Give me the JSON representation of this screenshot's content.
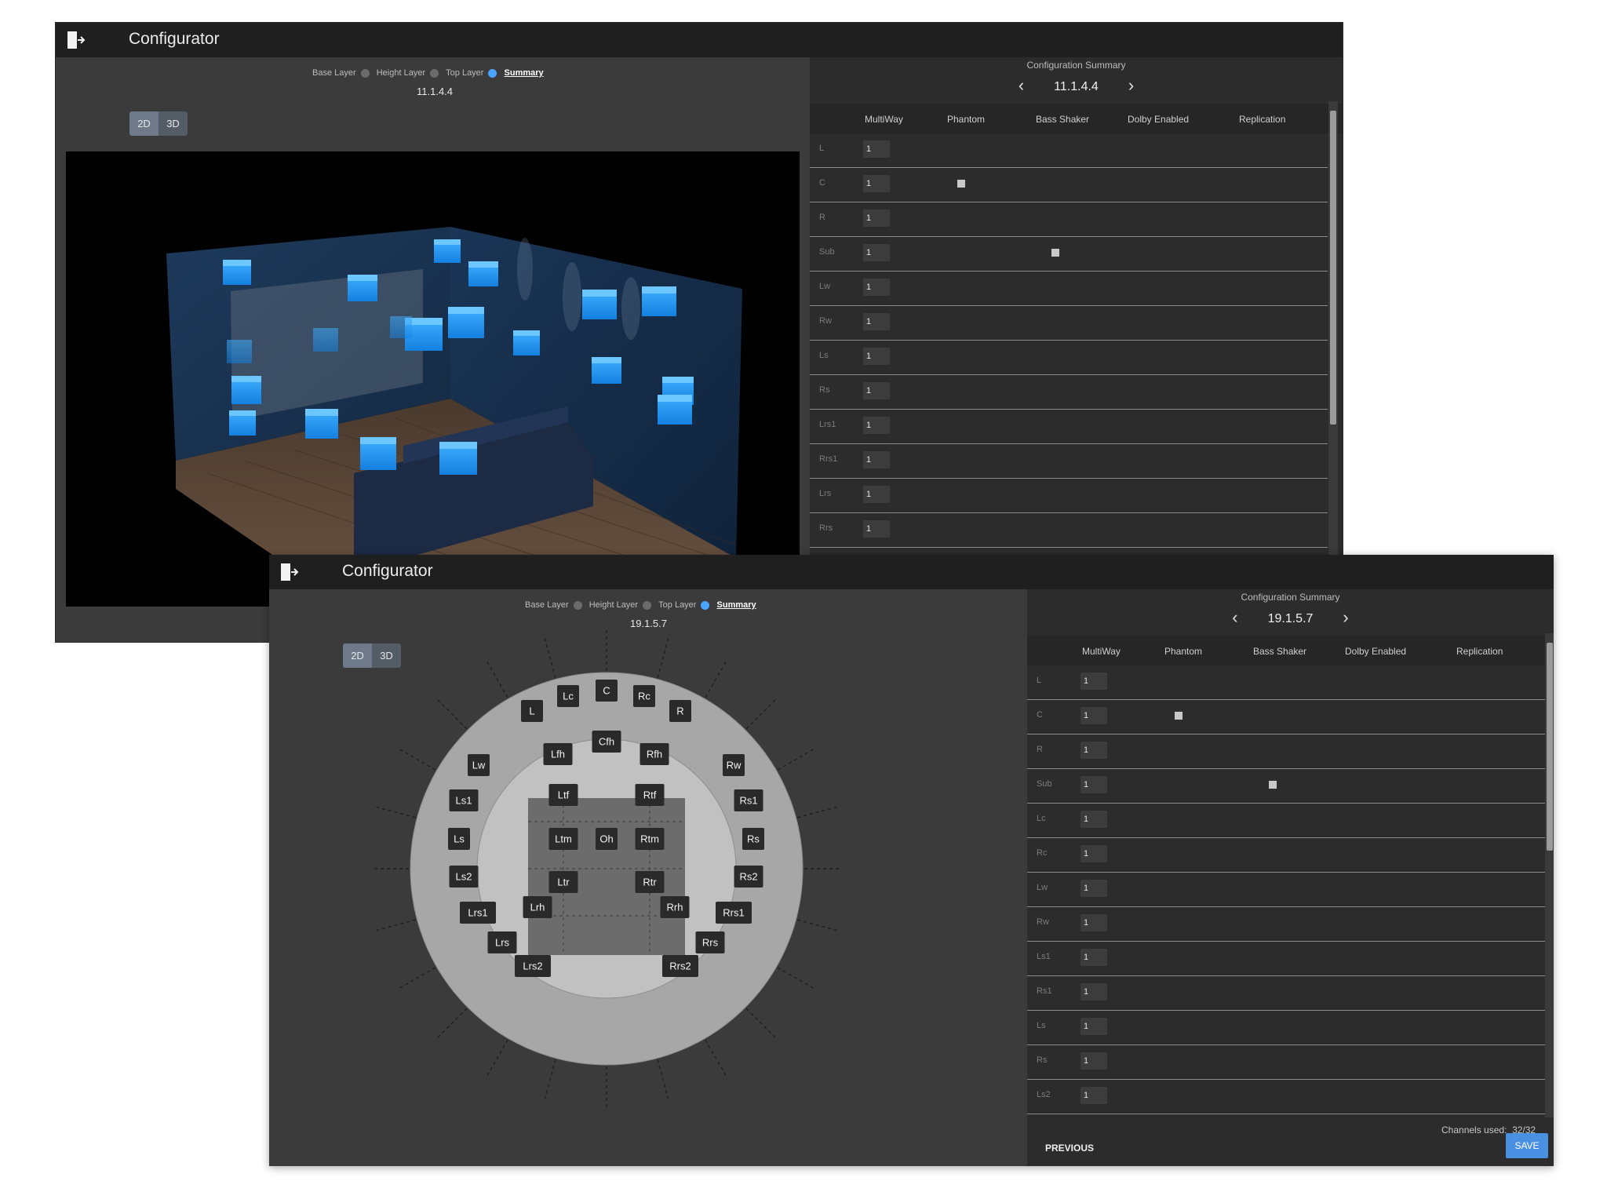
{
  "back": {
    "title": "Configurator",
    "layers": {
      "base": "Base Layer",
      "height": "Height Layer",
      "top": "Top Layer",
      "summary": "Summary"
    },
    "config_name": "11.1.4.4",
    "view_toggle": {
      "d2": "2D",
      "d3": "3D"
    },
    "summary_panel": {
      "title": "Configuration Summary",
      "config_name": "11.1.4.4",
      "columns": [
        "MultiWay",
        "Phantom",
        "Bass Shaker",
        "Dolby Enabled",
        "Replication"
      ],
      "rows": [
        {
          "label": "L",
          "multiway": "1",
          "phantom": false,
          "bass_shaker": false
        },
        {
          "label": "C",
          "multiway": "1",
          "phantom": true,
          "bass_shaker": false
        },
        {
          "label": "R",
          "multiway": "1",
          "phantom": false,
          "bass_shaker": false
        },
        {
          "label": "Sub",
          "multiway": "1",
          "phantom": false,
          "bass_shaker": true
        },
        {
          "label": "Lw",
          "multiway": "1",
          "phantom": false,
          "bass_shaker": false
        },
        {
          "label": "Rw",
          "multiway": "1",
          "phantom": false,
          "bass_shaker": false
        },
        {
          "label": "Ls",
          "multiway": "1",
          "phantom": false,
          "bass_shaker": false
        },
        {
          "label": "Rs",
          "multiway": "1",
          "phantom": false,
          "bass_shaker": false
        },
        {
          "label": "Lrs1",
          "multiway": "1",
          "phantom": false,
          "bass_shaker": false
        },
        {
          "label": "Rrs1",
          "multiway": "1",
          "phantom": false,
          "bass_shaker": false
        },
        {
          "label": "Lrs",
          "multiway": "1",
          "phantom": false,
          "bass_shaker": false
        },
        {
          "label": "Rrs",
          "multiway": "1",
          "phantom": false,
          "bass_shaker": false
        }
      ]
    }
  },
  "front": {
    "title": "Configurator",
    "layers": {
      "base": "Base Layer",
      "height": "Height Layer",
      "top": "Top Layer",
      "summary": "Summary"
    },
    "config_name": "19.1.5.7",
    "view_toggle": {
      "d2": "2D",
      "d3": "3D"
    },
    "speakers": {
      "C": "C",
      "Lc": "Lc",
      "Rc": "Rc",
      "L": "L",
      "R": "R",
      "Lw": "Lw",
      "Rw": "Rw",
      "Ls1": "Ls1",
      "Rs1": "Rs1",
      "Ls": "Ls",
      "Rs": "Rs",
      "Ls2": "Ls2",
      "Rs2": "Rs2",
      "Lrs1": "Lrs1",
      "Rrs1": "Rrs1",
      "Lrs": "Lrs",
      "Rrs": "Rrs",
      "Lrs2": "Lrs2",
      "Rrs2": "Rrs2",
      "Cfh": "Cfh",
      "Lfh": "Lfh",
      "Rfh": "Rfh",
      "Lrh": "Lrh",
      "Rrh": "Rrh",
      "Ltf": "Ltf",
      "Rtf": "Rtf",
      "Ltm": "Ltm",
      "Oh": "Oh",
      "Rtm": "Rtm",
      "Ltr": "Ltr",
      "Rtr": "Rtr"
    },
    "summary_panel": {
      "title": "Configuration Summary",
      "config_name": "19.1.5.7",
      "columns": [
        "MultiWay",
        "Phantom",
        "Bass Shaker",
        "Dolby Enabled",
        "Replication"
      ],
      "rows": [
        {
          "label": "L",
          "multiway": "1",
          "phantom": false,
          "bass_shaker": false
        },
        {
          "label": "C",
          "multiway": "1",
          "phantom": true,
          "bass_shaker": false
        },
        {
          "label": "R",
          "multiway": "1",
          "phantom": false,
          "bass_shaker": false
        },
        {
          "label": "Sub",
          "multiway": "1",
          "phantom": false,
          "bass_shaker": true
        },
        {
          "label": "Lc",
          "multiway": "1",
          "phantom": false,
          "bass_shaker": false
        },
        {
          "label": "Rc",
          "multiway": "1",
          "phantom": false,
          "bass_shaker": false
        },
        {
          "label": "Lw",
          "multiway": "1",
          "phantom": false,
          "bass_shaker": false
        },
        {
          "label": "Rw",
          "multiway": "1",
          "phantom": false,
          "bass_shaker": false
        },
        {
          "label": "Ls1",
          "multiway": "1",
          "phantom": false,
          "bass_shaker": false
        },
        {
          "label": "Rs1",
          "multiway": "1",
          "phantom": false,
          "bass_shaker": false
        },
        {
          "label": "Ls",
          "multiway": "1",
          "phantom": false,
          "bass_shaker": false
        },
        {
          "label": "Rs",
          "multiway": "1",
          "phantom": false,
          "bass_shaker": false
        },
        {
          "label": "Ls2",
          "multiway": "1",
          "phantom": false,
          "bass_shaker": false
        }
      ],
      "channels_label": "Channels used:",
      "channels_value": "32/32",
      "previous_label": "PREVIOUS",
      "save_label": "SAVE"
    }
  },
  "colors": {
    "accent": "#4a90e2",
    "active_dot": "#4aa3ff",
    "speaker_cube": "#1e90ff"
  }
}
